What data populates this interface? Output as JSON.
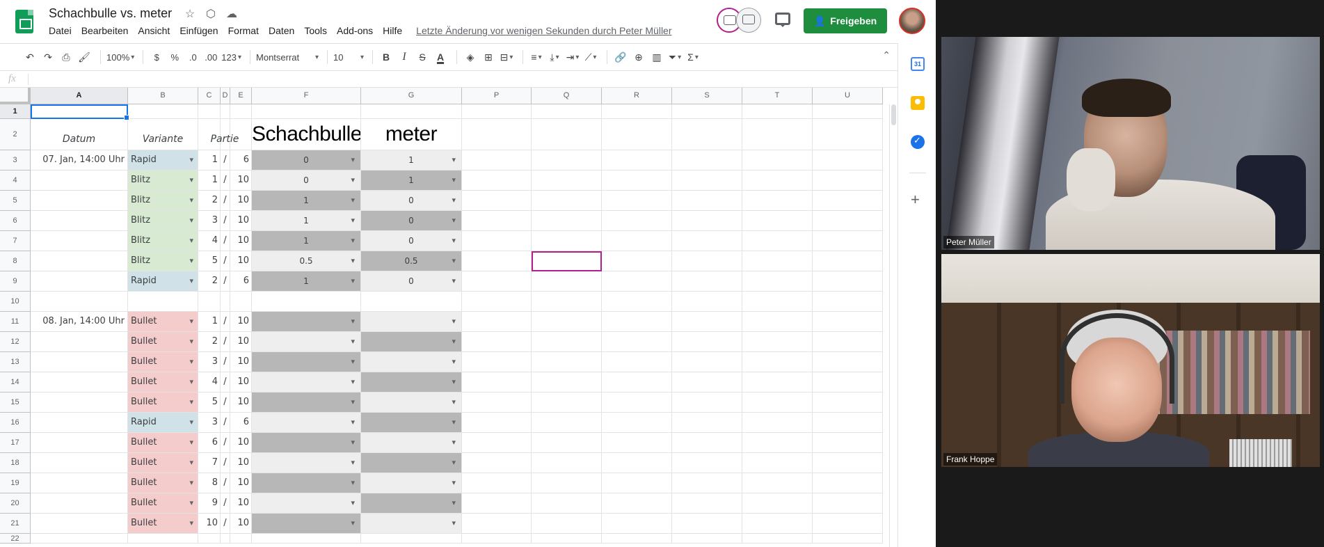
{
  "doc": {
    "title": "Schachbulle vs. meter"
  },
  "menu": [
    "Datei",
    "Bearbeiten",
    "Ansicht",
    "Einfügen",
    "Format",
    "Daten",
    "Tools",
    "Add-ons",
    "Hilfe"
  ],
  "last_edit": "Letzte Änderung vor wenigen Sekunden durch Peter Müller",
  "share_label": "Freigeben",
  "toolbar": {
    "zoom": "100%",
    "currency": "$",
    "percent": "%",
    "dec_less": ".0",
    "dec_more": ".00",
    "more_formats": "123",
    "font": "Montserrat",
    "font_size": "10",
    "bold": "B",
    "italic": "I",
    "strike": "S",
    "text_color": "A"
  },
  "formula_bar": {
    "fx": "fx",
    "value": ""
  },
  "columns": [
    "A",
    "B",
    "C",
    "D",
    "E",
    "F",
    "G",
    "P",
    "Q",
    "R",
    "S",
    "T",
    "U"
  ],
  "header_row": {
    "datum": "Datum",
    "variante": "Variante",
    "partie": "Partie",
    "player1": "Schachbulle",
    "player2": "meter"
  },
  "rows": [
    {
      "n": "1"
    },
    {
      "n": "2"
    },
    {
      "n": "3",
      "date": "07. Jan, 14:00 Uhr",
      "variant": "Rapid",
      "game": "1",
      "of": "6",
      "p1": "0",
      "p2": "1"
    },
    {
      "n": "4",
      "date": "",
      "variant": "Blitz",
      "game": "1",
      "of": "10",
      "p1": "0",
      "p2": "1"
    },
    {
      "n": "5",
      "date": "",
      "variant": "Blitz",
      "game": "2",
      "of": "10",
      "p1": "1",
      "p2": "0"
    },
    {
      "n": "6",
      "date": "",
      "variant": "Blitz",
      "game": "3",
      "of": "10",
      "p1": "1",
      "p2": "0"
    },
    {
      "n": "7",
      "date": "",
      "variant": "Blitz",
      "game": "4",
      "of": "10",
      "p1": "1",
      "p2": "0"
    },
    {
      "n": "8",
      "date": "",
      "variant": "Blitz",
      "game": "5",
      "of": "10",
      "p1": "0.5",
      "p2": "0.5"
    },
    {
      "n": "9",
      "date": "",
      "variant": "Rapid",
      "game": "2",
      "of": "6",
      "p1": "1",
      "p2": "0"
    },
    {
      "n": "10"
    },
    {
      "n": "11",
      "date": "08. Jan, 14:00 Uhr",
      "variant": "Bullet",
      "game": "1",
      "of": "10",
      "p1": "",
      "p2": ""
    },
    {
      "n": "12",
      "date": "",
      "variant": "Bullet",
      "game": "2",
      "of": "10",
      "p1": "",
      "p2": ""
    },
    {
      "n": "13",
      "date": "",
      "variant": "Bullet",
      "game": "3",
      "of": "10",
      "p1": "",
      "p2": ""
    },
    {
      "n": "14",
      "date": "",
      "variant": "Bullet",
      "game": "4",
      "of": "10",
      "p1": "",
      "p2": ""
    },
    {
      "n": "15",
      "date": "",
      "variant": "Bullet",
      "game": "5",
      "of": "10",
      "p1": "",
      "p2": ""
    },
    {
      "n": "16",
      "date": "",
      "variant": "Rapid",
      "game": "3",
      "of": "6",
      "p1": "",
      "p2": ""
    },
    {
      "n": "17",
      "date": "",
      "variant": "Bullet",
      "game": "6",
      "of": "10",
      "p1": "",
      "p2": ""
    },
    {
      "n": "18",
      "date": "",
      "variant": "Bullet",
      "game": "7",
      "of": "10",
      "p1": "",
      "p2": ""
    },
    {
      "n": "19",
      "date": "",
      "variant": "Bullet",
      "game": "8",
      "of": "10",
      "p1": "",
      "p2": ""
    },
    {
      "n": "20",
      "date": "",
      "variant": "Bullet",
      "game": "9",
      "of": "10",
      "p1": "",
      "p2": ""
    },
    {
      "n": "21",
      "date": "",
      "variant": "Bullet",
      "game": "10",
      "of": "10",
      "p1": "",
      "p2": ""
    },
    {
      "n": "22"
    }
  ],
  "colors": {
    "rapid": "#d0e2e8",
    "blitz": "#d9ead3",
    "bullet": "#f4cccc",
    "result_light": "#eeeeee",
    "result_dark": "#b7b7b7",
    "share": "#1e8e3e",
    "selection": "#1a73e8",
    "collab_cursor": "#b0208a"
  },
  "rail": {
    "calendar_day": "31"
  },
  "video": {
    "participants": [
      "Peter Müller",
      "Frank Hoppe"
    ]
  }
}
